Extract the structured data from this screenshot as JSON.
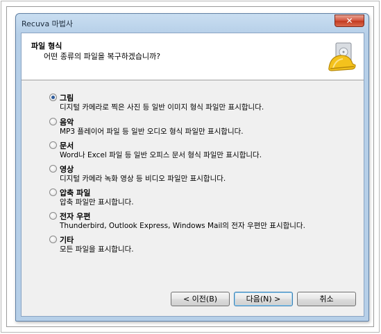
{
  "window": {
    "title": "Recuva 마법사",
    "close_glyph": "✕"
  },
  "header": {
    "title": "파일 형식",
    "subtitle": "어떤 종류의 파일을 복구하겠습니까?",
    "icon": "recuva-hardhat-icon"
  },
  "options": [
    {
      "label": "그림",
      "desc": "디지털 카메라로 찍은 사진 등 일반 이미지 형식 파일만 표시합니다.",
      "checked": true
    },
    {
      "label": "음악",
      "desc": "MP3 플레이어 파일 등 일반 오디오 형식 파일만 표시합니다.",
      "checked": false
    },
    {
      "label": "문서",
      "desc": "Word나 Excel 파일 등 일반 오피스 문서 형식 파일만 표시합니다.",
      "checked": false
    },
    {
      "label": "영상",
      "desc": "디지털 카메라 녹화 영상 등 비디오 파일만 표시합니다.",
      "checked": false
    },
    {
      "label": "압축 파일",
      "desc": "압축 파일만 표시합니다.",
      "checked": false
    },
    {
      "label": "전자 우편",
      "desc": "Thunderbird, Outlook Express, Windows Mail의 전자 우편만 표시합니다.",
      "checked": false
    },
    {
      "label": "기타",
      "desc": "모든 파일을 표시합니다.",
      "checked": false
    }
  ],
  "buttons": {
    "back": "< 이전(B)",
    "next": "다음(N) >",
    "cancel": "취소"
  }
}
